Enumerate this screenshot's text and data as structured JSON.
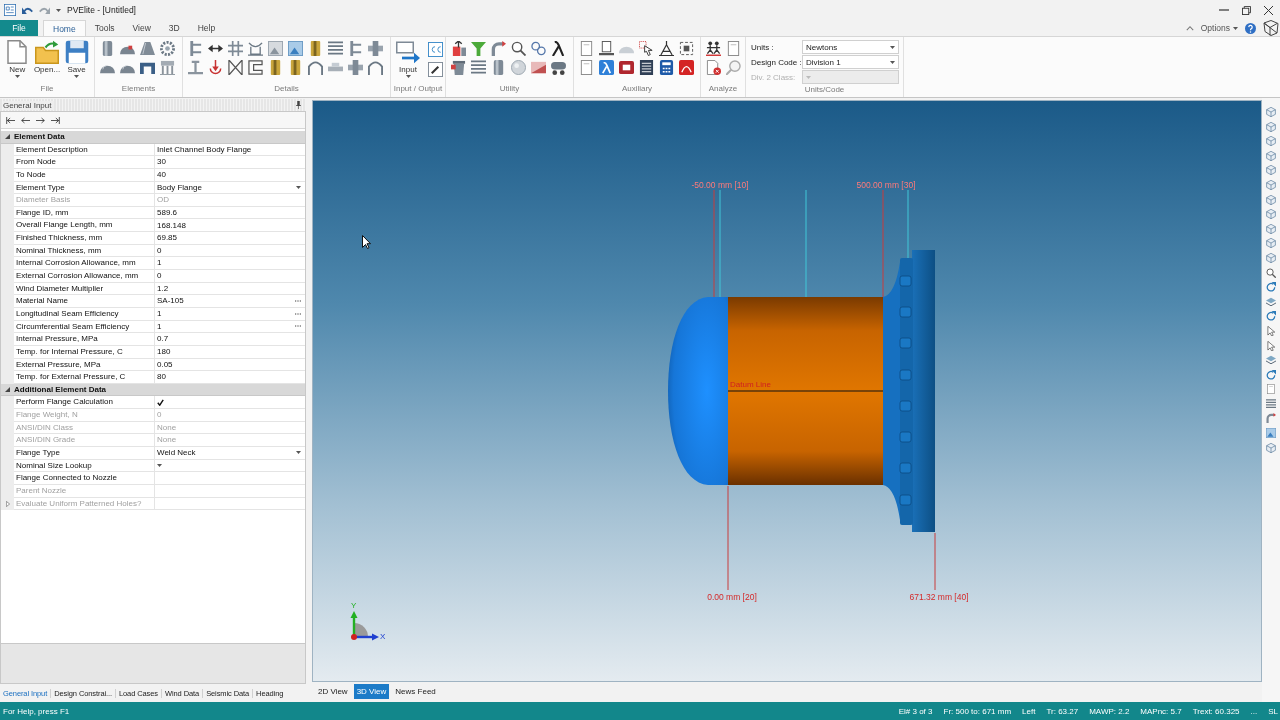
{
  "window": {
    "title": "PVElite - [Untitled]"
  },
  "menu_tabs": [
    {
      "label": "File",
      "kind": "file",
      "selected": false
    },
    {
      "label": "Home",
      "kind": "tab",
      "selected": true
    },
    {
      "label": "Tools",
      "kind": "tab",
      "selected": false
    },
    {
      "label": "View",
      "kind": "tab",
      "selected": false
    },
    {
      "label": "3D",
      "kind": "tab",
      "selected": false
    },
    {
      "label": "Help",
      "kind": "tab",
      "selected": false
    }
  ],
  "options_menu": {
    "label": "Options"
  },
  "ribbon": {
    "groups": [
      {
        "label": "File",
        "kind": "file",
        "buttons": [
          {
            "label": "New",
            "dropdown": true
          },
          {
            "label": "Open...",
            "dropdown": false
          },
          {
            "label": "Save",
            "dropdown": true
          }
        ]
      },
      {
        "label": "Elements",
        "kind": "elements"
      },
      {
        "label": "Details",
        "kind": "details"
      },
      {
        "label": "Input / Output",
        "kind": "io",
        "buttons": [
          {
            "label": "Input",
            "dropdown": true
          }
        ]
      },
      {
        "label": "Utility",
        "kind": "utility"
      },
      {
        "label": "Auxiliary",
        "kind": "auxiliary"
      },
      {
        "label": "Analyze",
        "kind": "analyze"
      },
      {
        "label": "Units/Code",
        "kind": "units",
        "fields": [
          {
            "label": "Units :",
            "value": "Newtons",
            "disabled": false
          },
          {
            "label": "Design Code :",
            "value": "Division 1",
            "disabled": false
          },
          {
            "label": "Div. 2 Class:",
            "disabled": true
          }
        ]
      }
    ]
  },
  "general_input": {
    "title": "General Input",
    "sections": [
      {
        "title": "Element Data",
        "expanded": true,
        "rows": [
          {
            "label": "Element Description",
            "kind": "text",
            "value": "Inlet Channel Body Flange",
            "disabled": false
          },
          {
            "label": "From Node",
            "kind": "text",
            "value": "30",
            "disabled": false
          },
          {
            "label": "To Node",
            "kind": "text",
            "value": "40",
            "disabled": false
          },
          {
            "label": "Element Type",
            "kind": "dropdown",
            "value": "Body Flange",
            "disabled": false
          },
          {
            "label": "Diameter Basis",
            "kind": "text",
            "value": "OD",
            "disabled": true
          },
          {
            "label": "Flange ID, mm",
            "kind": "text",
            "value": "589.6",
            "disabled": false
          },
          {
            "label": "Overall Flange Length, mm",
            "kind": "text",
            "value": "168.148",
            "disabled": false
          },
          {
            "label": "Finished Thickness, mm",
            "kind": "text",
            "value": "69.85",
            "disabled": false
          },
          {
            "label": "Nominal Thickness, mm",
            "kind": "text",
            "value": "0",
            "disabled": false
          },
          {
            "label": "Internal Corrosion Allowance, mm",
            "kind": "text",
            "value": "1",
            "disabled": false
          },
          {
            "label": "External Corrosion Allowance, mm",
            "kind": "text",
            "value": "0",
            "disabled": false
          },
          {
            "label": "Wind Diameter Multiplier",
            "kind": "text",
            "value": "1.2",
            "disabled": false
          },
          {
            "label": "Material Name",
            "kind": "ellipsis",
            "value": "SA-105",
            "disabled": false
          },
          {
            "label": "Longitudinal Seam Efficiency",
            "kind": "ellipsis",
            "value": "1",
            "disabled": false
          },
          {
            "label": "Circumferential Seam Efficiency",
            "kind": "ellipsis",
            "value": "1",
            "disabled": false
          },
          {
            "label": "Internal Pressure, MPa",
            "kind": "text",
            "value": "0.7",
            "disabled": false
          },
          {
            "label": "Temp. for Internal Pressure, C",
            "kind": "text",
            "value": "180",
            "disabled": false
          },
          {
            "label": "External Pressure, MPa",
            "kind": "text",
            "value": "0.05",
            "disabled": false
          },
          {
            "label": "Temp. for External Pressure, C",
            "kind": "text",
            "value": "80",
            "disabled": false
          }
        ]
      },
      {
        "title": "Additional Element Data",
        "expanded": true,
        "rows": [
          {
            "label": "Perform Flange Calculation",
            "kind": "check",
            "checked": true,
            "disabled": false
          },
          {
            "label": "Flange Weight, N",
            "kind": "text",
            "value": "0",
            "disabled": true
          },
          {
            "label": "ANSI/DIN Class",
            "kind": "text",
            "value": "None",
            "disabled": true
          },
          {
            "label": "ANSI/DIN Grade",
            "kind": "text",
            "value": "None",
            "disabled": true
          },
          {
            "label": "Flange Type",
            "kind": "dropdown",
            "value": "Weld Neck",
            "disabled": false
          },
          {
            "label": "Nominal Size Lookup",
            "kind": "dropdown",
            "disabled": false
          },
          {
            "label": "Flange Connected to Nozzle",
            "kind": "text",
            "disabled": false
          },
          {
            "label": "Parent Nozzle",
            "kind": "text",
            "disabled": true
          },
          {
            "label": "Evaluate Uniform Patterned Holes?",
            "kind": "expander",
            "expanded": false,
            "disabled": true
          }
        ]
      }
    ],
    "tabs": [
      {
        "label": "General Input",
        "selected": true
      },
      {
        "label": "Design Constrai...",
        "selected": false
      },
      {
        "label": "Load Cases",
        "selected": false
      },
      {
        "label": "Wind Data",
        "selected": false
      },
      {
        "label": "Seismic Data",
        "selected": false
      },
      {
        "label": "Heading",
        "selected": false
      }
    ]
  },
  "view": {
    "dimension_labels_top": [
      "-50.00 mm [10]",
      "500.00 mm [30]"
    ],
    "datum_label": "Datum Line",
    "dimension_labels_bottom": [
      "0.00 mm [20]",
      "671.32 mm [40]"
    ],
    "axis_labels": [
      "Y",
      "X"
    ],
    "tabs": [
      {
        "label": "2D View",
        "selected": false
      },
      {
        "label": "3D View",
        "selected": true
      },
      {
        "label": "News Feed",
        "selected": false
      }
    ]
  },
  "status_bar": {
    "help": "For Help, press F1",
    "fields": [
      "El# 3 of 3",
      "Fr: 500 to: 671 mm",
      "Left",
      "Tr: 63.27",
      "MAWP: 2.2",
      "MAPnc: 5.7",
      "Trext: 60.325",
      "...",
      "SL"
    ]
  }
}
